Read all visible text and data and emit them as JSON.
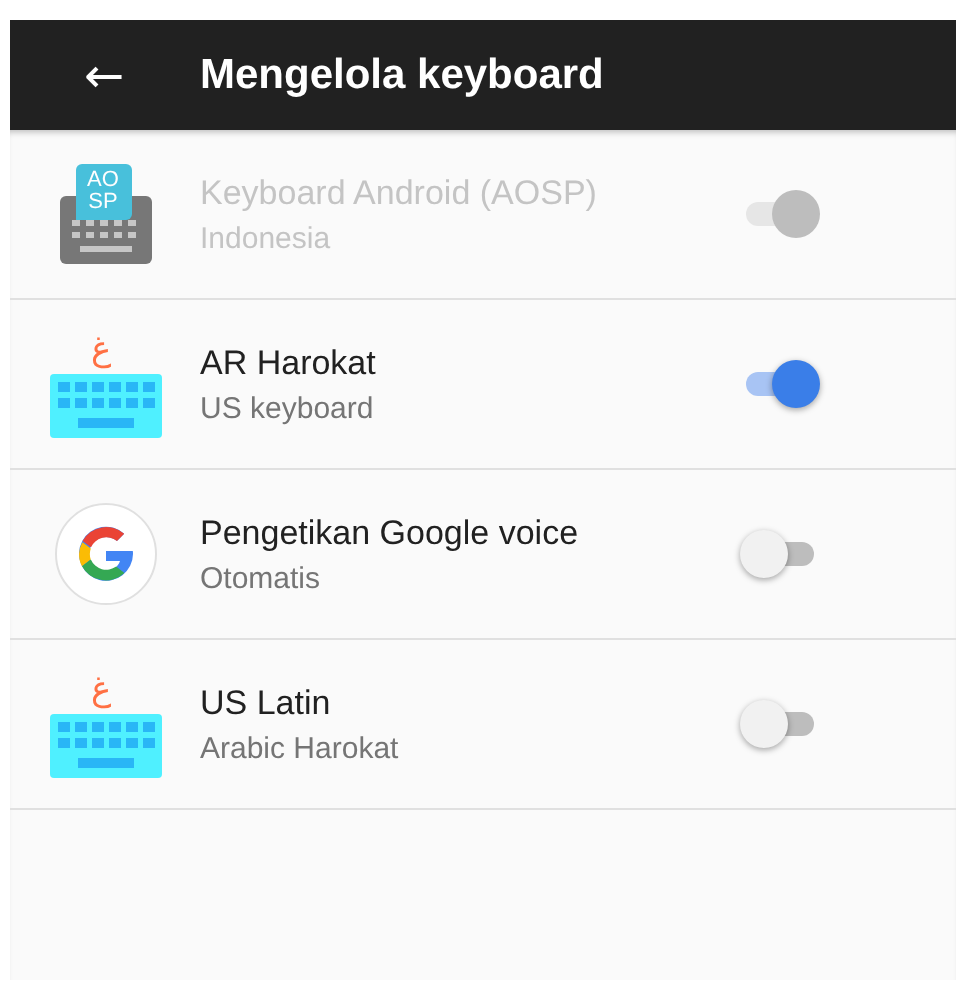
{
  "app_bar": {
    "back_icon": "←",
    "title": "Mengelola keyboard"
  },
  "keyboards": [
    {
      "kind": "aosp",
      "icon_text": [
        "AO",
        "SP"
      ],
      "name": "Keyboard Android (AOSP)",
      "subtitle": "Indonesia",
      "on": true,
      "disabled": true
    },
    {
      "kind": "arabic",
      "icon_text": [
        "غ"
      ],
      "name": "AR Harokat",
      "subtitle": "US keyboard",
      "on": true,
      "disabled": false
    },
    {
      "kind": "google",
      "name": "Pengetikan Google voice",
      "subtitle": "Otomatis",
      "on": false,
      "disabled": false
    },
    {
      "kind": "arabic",
      "icon_text": [
        "غ"
      ],
      "name": "US Latin",
      "subtitle": "Arabic Harokat",
      "on": false,
      "disabled": false
    }
  ]
}
